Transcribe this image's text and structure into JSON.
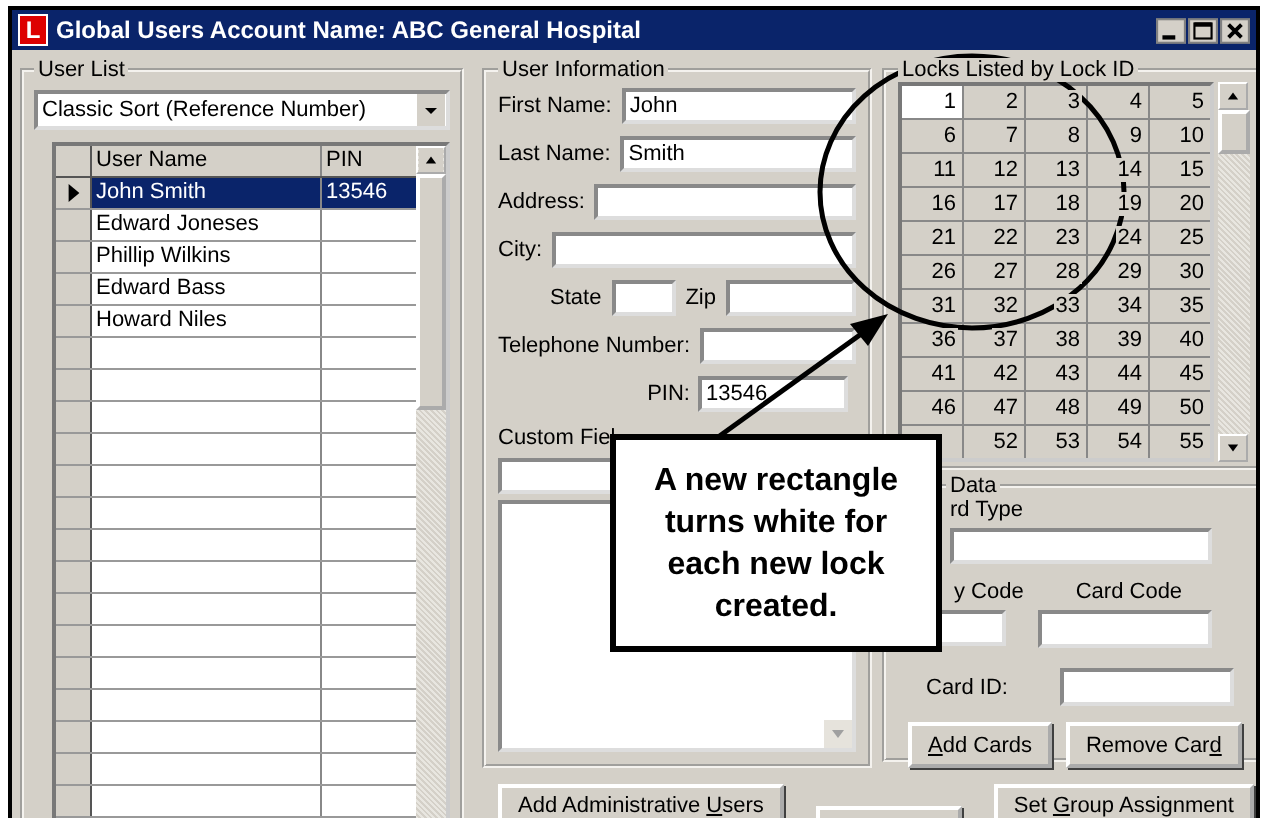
{
  "window": {
    "app_icon": "L",
    "title": "Global Users Account Name: ABC General Hospital"
  },
  "user_list": {
    "legend": "User List",
    "sort": "Classic Sort (Reference Number)",
    "columns": [
      "User Name",
      "PIN"
    ],
    "rows": [
      {
        "name": "John Smith",
        "pin": "13546",
        "selected": true
      },
      {
        "name": "Edward Joneses",
        "selected": false
      },
      {
        "name": "Phillip Wilkins",
        "selected": false
      },
      {
        "name": "Edward Bass",
        "selected": false
      },
      {
        "name": "Howard Niles",
        "selected": false
      }
    ]
  },
  "user_info": {
    "legend": "User Information",
    "fields": [
      {
        "kind": "wide",
        "label": "First Name:",
        "value": "John"
      },
      {
        "kind": "wide",
        "label": "Last Name:",
        "value": "Smith"
      },
      {
        "kind": "wide",
        "label": "Address:"
      },
      {
        "kind": "wide",
        "label": "City:"
      },
      {
        "kind": "pair",
        "label": "State",
        "label2": "Zip"
      },
      {
        "kind": "wide",
        "label": "Telephone Number:"
      },
      {
        "kind": "right",
        "label": "PIN:",
        "value": "13546"
      }
    ],
    "custom_label": "Custom Fiel"
  },
  "locks": {
    "legend": "Locks Listed by Lock ID",
    "cells": [
      {
        "label": "1",
        "unused": false
      },
      {
        "label": "2",
        "unused": true
      },
      {
        "label": "3",
        "unused": true
      },
      {
        "label": "4",
        "unused": true
      },
      {
        "label": "5",
        "unused": true
      },
      {
        "label": "6",
        "unused": true
      },
      {
        "label": "7",
        "unused": true
      },
      {
        "label": "8",
        "unused": true
      },
      {
        "label": "9",
        "unused": true
      },
      {
        "label": "10",
        "unused": true
      },
      {
        "label": "11",
        "unused": true
      },
      {
        "label": "12",
        "unused": true
      },
      {
        "label": "13",
        "unused": true
      },
      {
        "label": "14",
        "unused": true
      },
      {
        "label": "15",
        "unused": true
      },
      {
        "label": "16",
        "unused": true
      },
      {
        "label": "17",
        "unused": true
      },
      {
        "label": "18",
        "unused": true
      },
      {
        "label": "19",
        "unused": true
      },
      {
        "label": "20",
        "unused": true
      },
      {
        "label": "21",
        "unused": true
      },
      {
        "label": "22",
        "unused": true
      },
      {
        "label": "23",
        "unused": true
      },
      {
        "label": "24",
        "unused": true
      },
      {
        "label": "25",
        "unused": true
      },
      {
        "label": "26",
        "unused": true
      },
      {
        "label": "27",
        "unused": true
      },
      {
        "label": "28",
        "unused": true
      },
      {
        "label": "29",
        "unused": true
      },
      {
        "label": "30",
        "unused": true
      },
      {
        "label": "31",
        "unused": true
      },
      {
        "label": "32",
        "unused": true
      },
      {
        "label": "33",
        "unused": true
      },
      {
        "label": "34",
        "unused": true
      },
      {
        "label": "35",
        "unused": true
      },
      {
        "label": "36",
        "unused": true
      },
      {
        "label": "37",
        "unused": true
      },
      {
        "label": "38",
        "unused": true
      },
      {
        "label": "39",
        "unused": true
      },
      {
        "label": "40",
        "unused": true
      },
      {
        "label": "41",
        "unused": true
      },
      {
        "label": "42",
        "unused": true
      },
      {
        "label": "43",
        "unused": true
      },
      {
        "label": "44",
        "unused": true
      },
      {
        "label": "45",
        "unused": true
      },
      {
        "label": "46",
        "unused": true
      },
      {
        "label": "47",
        "unused": true
      },
      {
        "label": "48",
        "unused": true
      },
      {
        "label": "49",
        "unused": true
      },
      {
        "label": "50",
        "unused": true
      },
      {
        "unused": true
      },
      {
        "label": "52",
        "unused": true
      },
      {
        "label": "53",
        "unused": true
      },
      {
        "label": "54",
        "unused": true
      },
      {
        "label": "55",
        "unused": true
      }
    ]
  },
  "card_data": {
    "legend": "Data",
    "type_label": "rd Type",
    "facility_label": "y Code",
    "code_label": "Card Code",
    "id_label": "Card ID:",
    "buttons": [
      {
        "parts": [
          {
            "text": "A",
            "underlined": true
          },
          {
            "text": "dd Cards",
            "underlined": false
          }
        ]
      },
      {
        "parts": [
          {
            "text": "Remove Car",
            "underlined": false
          },
          {
            "text": "d",
            "underlined": true
          }
        ]
      }
    ]
  },
  "bottom_buttons": [
    {
      "parts": [
        {
          "text": "Add Administrative ",
          "underlined": false
        },
        {
          "text": "U",
          "underlined": true
        },
        {
          "text": "sers",
          "underlined": false
        }
      ]
    },
    {
      "parts": [
        {
          "text": "Set ",
          "underlined": false
        },
        {
          "text": "G",
          "underlined": true
        },
        {
          "text": "roup Assignment",
          "underlined": false
        }
      ]
    }
  ],
  "callout": {
    "text": "A new rectangle turns white for each new lock created."
  }
}
